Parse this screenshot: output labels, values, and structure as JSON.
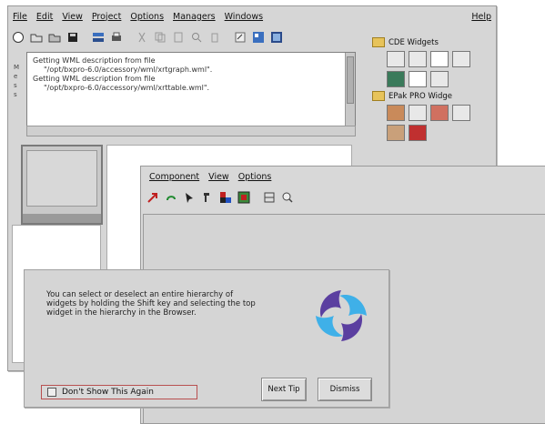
{
  "main": {
    "menus": [
      "File",
      "Edit",
      "View",
      "Project",
      "Options",
      "Managers",
      "Windows"
    ],
    "help": "Help",
    "toolbar_icons": [
      "new-icon",
      "open-icon",
      "folder-icon",
      "save-icon",
      "sep",
      "tree-icon",
      "print-icon",
      "sep",
      "cut-icon",
      "copy-icon",
      "paste-icon",
      "find-icon",
      "delete-icon",
      "sep",
      "edit-icon",
      "browse-icon",
      "layout-icon"
    ],
    "messages": [
      "Getting WML description from file",
      "\"/opt/bxpro-6.0/accessory/wml/xrtgraph.wml\".",
      "Getting WML description from file",
      "\"/opt/bxpro-6.0/accessory/wml/xrttable.wml\"."
    ],
    "side_tabs": "M\ne\ns\ns",
    "palette": {
      "group1": "CDE Widgets",
      "group2": "EPak PRO Widge"
    }
  },
  "browser": {
    "menus": [
      "Component",
      "View",
      "Options"
    ],
    "toolbar_icons": [
      "red-arrow-icon",
      "green-arrow-icon",
      "cursor-icon",
      "pointer-icon",
      "tree-color-icon",
      "grid-icon",
      "sep",
      "panel-icon",
      "search-icon"
    ]
  },
  "tip": {
    "text": "You can select or deselect an entire hierarchy of widgets by holding the Shift key and selecting the top widget in the hierarchy in the Browser.",
    "dont_show": "Don't Show This Again",
    "next": "Next Tip",
    "dismiss": "Dismiss"
  },
  "colors": {
    "logo_purple": "#5b3fa0",
    "logo_blue": "#3fb0e8",
    "chrome": "#d6d6d6"
  }
}
